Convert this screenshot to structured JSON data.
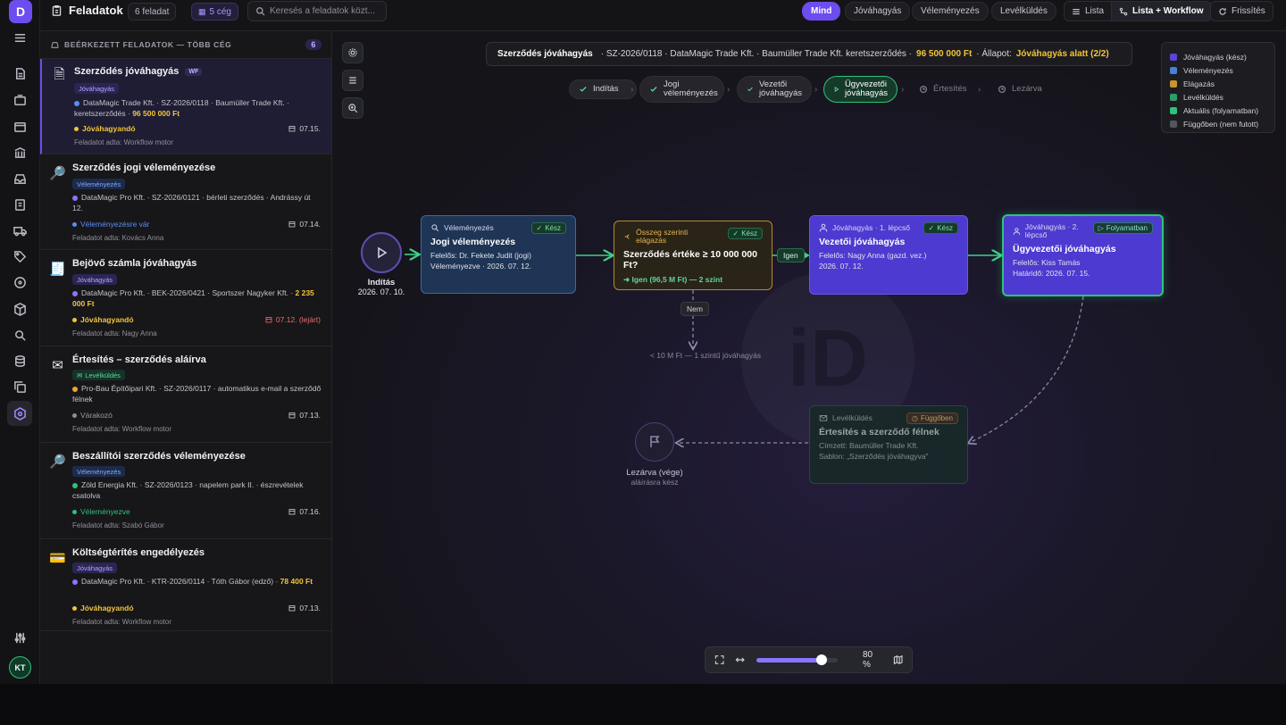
{
  "app": {
    "logo": "D",
    "user_initials": "KT",
    "accent": "#6d4cf0"
  },
  "topbar": {
    "title": "Feladatok",
    "task_count": "6 feladat",
    "company_count": "5 cég",
    "search_placeholder": "Keresés a feladatok közt...",
    "filters": [
      "Mind",
      "Jóváhagyás",
      "Véleményezés",
      "Levélküldés"
    ],
    "active_filter": "Mind",
    "view_list": "Lista",
    "view_list_workflow": "Lista + Workflow",
    "refresh": "Frissítés"
  },
  "list": {
    "heading": "BEÉRKEZETT FELADATOK — TÖBB CÉG",
    "count": "6",
    "tasks": [
      {
        "icon": "contract-icon",
        "title": "Szerződés jóváhagyás",
        "wf": "WF",
        "tag": "Jóváhagyás",
        "desc": "DataMagic Trade Kft. · SZ-2026/0118 · Baumüller Trade Kft. · keretszerződés · ",
        "amount": "96 500 000 Ft",
        "dot": "#5b8def",
        "status": "Jóváhagyandó",
        "status_color": "#f2c43b",
        "date": "07.15.",
        "by": "Feladatot adta: Workflow motor"
      },
      {
        "icon": "magnifier-icon",
        "title": "Szerződés jogi véleményezése",
        "tag": "Véleményezés",
        "desc": "DataMagic Pro Kft. · SZ-2026/0121 · bérleti szerződés · Andrássy út 12.",
        "dot": "#8b74ff",
        "status": "Véleményezésre vár",
        "status_color": "#5b8def",
        "date": "07.14.",
        "by": "Feladatot adta: Kovács Anna"
      },
      {
        "icon": "invoice-icon",
        "title": "Bejövő számla jóváhagyás",
        "tag": "Jóváhagyás",
        "desc": "DataMagic Pro Kft. · BEK-2026/0421 · Sportszer Nagyker Kft. · ",
        "amount": "2 235 000 Ft",
        "dot": "#8b74ff",
        "status": "Jóváhagyandó",
        "status_color": "#f2c43b",
        "date": "07.12. (lejárt)",
        "date_color": "#f06a6a",
        "by": "Feladatot adta: Nagy Anna"
      },
      {
        "icon": "envelope-icon",
        "title": "Értesítés – szerződés aláírva",
        "tag": "Levélküldés",
        "desc": "Pro-Bau Építőipari Kft. · SZ-2026/0117 · automatikus e-mail a szerződő félnek",
        "dot": "#f0a23b",
        "status": "Várakozó",
        "status_color": "#8f8f99",
        "date": "07.13.",
        "by": "Feladatot adta: Workflow motor"
      },
      {
        "icon": "magnifier-icon",
        "title": "Beszállítói szerződés véleményezése",
        "tag": "Véleményezés",
        "desc": "Zöld Energia Kft. · SZ-2026/0123 · napelem park II. · észrevételek csatolva",
        "dot": "#2fc27a",
        "status": "Véleményezve",
        "status_color": "#2fc27a",
        "date": "07.16.",
        "by": "Feladatot adta: Szabó Gábor"
      },
      {
        "icon": "card-icon",
        "title": "Költségtérítés engedélyezés",
        "tag": "Jóváhagyás",
        "desc": "DataMagic Pro Kft. · KTR-2026/0114 · Tóth Gábor (edző) · ",
        "amount": "78 400 Ft",
        "dot": "#8b74ff",
        "status": "Jóváhagyandó",
        "status_color": "#f2c43b",
        "date": "07.13.",
        "by": "Feladatot adta: Workflow motor"
      }
    ]
  },
  "workflow": {
    "header": {
      "title": "Szerződés jóváhagyás",
      "ref": "· SZ-2026/0118 · DataMagic Trade Kft. · Baumüller Trade Kft. keretszerződés ·",
      "amount": "96 500 000 Ft",
      "state_label": "· Állapot:",
      "state": "Jóváhagyás alatt (2/2)"
    },
    "steps": [
      "Indítás",
      "Jogi véleményezés",
      "Vezetői jóváhagyás",
      "Ügyvezetői jóváhagyás",
      "Értesítés",
      "Lezárva"
    ],
    "legend": [
      {
        "label": "Jóváhagyás (kész)",
        "color": "#5b45d6"
      },
      {
        "label": "Véleményezés",
        "color": "#4a7fd6"
      },
      {
        "label": "Elágazás",
        "color": "#c9962e"
      },
      {
        "label": "Levélküldés",
        "color": "#2f9a6b"
      },
      {
        "label": "Aktuális (folyamatban)",
        "color": "#2fc27a"
      },
      {
        "label": "Függőben (nem futott)",
        "color": "#55555e"
      }
    ],
    "start": {
      "label": "Indítás",
      "date": "2026. 07. 10."
    },
    "end": {
      "label": "Lezárva (vége)",
      "sub": "aláírásra kész"
    },
    "nodes": {
      "review": {
        "kind": "Véleményezés",
        "badge": "Kész",
        "title": "Jogi véleményezés",
        "l1": "Felelős: Dr. Fekete Judit (jogi)",
        "l2": "Véleményezve · 2026. 07. 12."
      },
      "branch": {
        "kind": "Összeg szerinti elágazás",
        "badge": "Kész",
        "title": "Szerződés értéke ≥ 10 000 000 Ft?",
        "l1": "➜ Igen (96,5 M Ft) — 2 szint"
      },
      "mgr": {
        "kind": "Jóváhagyás · 1. lépcső",
        "badge": "Kész",
        "title": "Vezetői jóváhagyás",
        "l1": "Felelős: Nagy Anna (gazd. vez.)",
        "l2": "2026. 07. 12."
      },
      "ceo": {
        "kind": "Jóváhagyás · 2. lépcső",
        "badge": "Folyamatban",
        "title": "Ügyvezetői jóváhagyás",
        "l1": "Felelős: Kiss Tamás",
        "l2": "Határidő: 2026. 07. 15."
      },
      "notify": {
        "kind": "Levélküldés",
        "badge": "Függőben",
        "title": "Értesítés a szerződő félnek",
        "l1": "Címzett: Baumüller Trade Kft.",
        "l2": "Sablon: „Szerződés jóváhagyva\""
      }
    },
    "edge_yes": "Igen",
    "edge_no": "Nem",
    "edge_no_note": "< 10 M Ft — 1 szintű jóváhagyás",
    "watermark": "iD",
    "zoom": {
      "value": 0.8,
      "label": "80 %"
    }
  }
}
